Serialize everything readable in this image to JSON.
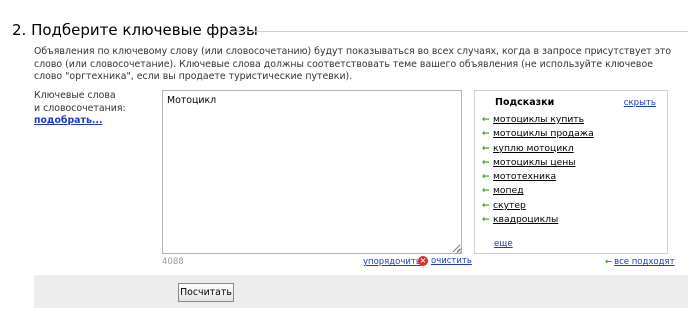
{
  "section": {
    "title": "2. Подберите ключевые фразы"
  },
  "description": "Объявления по ключевому слову (или словосочетанию) будут показываться во всех случаях, когда в запросе присутствует это слово (или словосочетание). Ключевые слова должны соответствовать теме вашего объявления (не используйте ключевое слово \"оргтехника\", если вы продаете туристические путевки).",
  "keywords": {
    "label_line1": "Ключевые слова",
    "label_line2": "и словосочетания:",
    "pick_link": "подобрать...",
    "value": "Мотоцикл",
    "char_counter": "4088",
    "sort_link": "упорядочить",
    "clear_link": "очистить"
  },
  "hints": {
    "title": "Подсказки",
    "hide_link": "скрыть",
    "items": [
      "мотоциклы купить",
      "мотоциклы продажа",
      "куплю мотоцикл",
      "мотоциклы цены",
      "мототехника",
      "мопед",
      "скутер",
      "квадроциклы"
    ],
    "more_link": "еще",
    "all_fit_link": "все подходят"
  },
  "actions": {
    "calculate_button": "Посчитать"
  },
  "colors": {
    "link": "#1a3dc1",
    "hint_arrow": "#3a9a1a",
    "clear_icon": "#dd2b2b",
    "footer_bg": "#ededed"
  },
  "icons": {
    "hint_arrow": "arrow-left-icon",
    "clear": "clear-icon"
  }
}
